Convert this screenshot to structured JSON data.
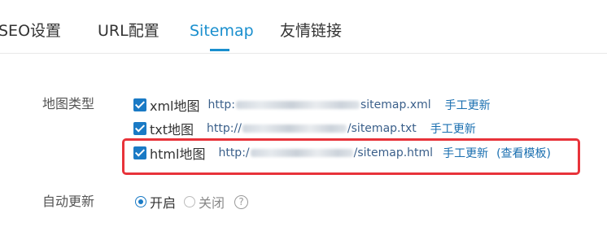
{
  "tabs": [
    {
      "label": "SEO设置",
      "active": false
    },
    {
      "label": "URL配置",
      "active": false
    },
    {
      "label": "Sitemap",
      "active": true
    },
    {
      "label": "友情链接",
      "active": false
    }
  ],
  "map_type": {
    "label": "地图类型",
    "items": [
      {
        "name": "xml地图",
        "checked": true,
        "url_prefix": "http:",
        "url_suffix": "sitemap.xml",
        "manual_update": "手工更新"
      },
      {
        "name": "txt地图",
        "checked": true,
        "url_prefix": "http://",
        "url_suffix": "/sitemap.txt",
        "manual_update": "手工更新"
      },
      {
        "name": "html地图",
        "checked": true,
        "url_prefix": "http:/",
        "url_suffix": "/sitemap.html",
        "manual_update": "手工更新",
        "view_template": "(查看模板)"
      }
    ]
  },
  "auto_update": {
    "label": "自动更新",
    "options": [
      {
        "label": "开启",
        "checked": true
      },
      {
        "label": "关闭",
        "checked": false
      }
    ],
    "help": "?"
  },
  "colors": {
    "accent": "#1a8fce",
    "link": "#1a6fb0",
    "highlight": "#e8333a"
  }
}
